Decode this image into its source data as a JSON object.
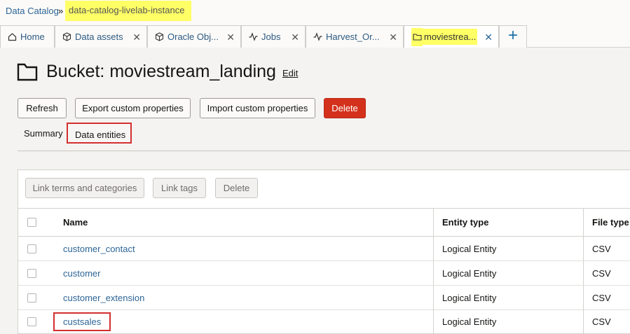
{
  "breadcrumb": {
    "root": "Data Catalog",
    "sep": "»",
    "current": "data-catalog-livelab-instance"
  },
  "tabs": [
    {
      "label": "Home",
      "icon": "home-icon"
    },
    {
      "label": "Data assets",
      "icon": "cube-icon"
    },
    {
      "label": "Oracle Obj...",
      "icon": "cube-icon"
    },
    {
      "label": "Jobs",
      "icon": "activity-icon"
    },
    {
      "label": "Harvest_Or...",
      "icon": "activity-icon"
    },
    {
      "label": "moviestrea...",
      "icon": "folder-icon"
    }
  ],
  "close_symbol": "✕",
  "add_symbol": "+",
  "title": {
    "text": "Bucket: moviestream_landing",
    "edit": "Edit"
  },
  "actions": {
    "refresh": "Refresh",
    "export": "Export custom properties",
    "import": "Import custom properties",
    "delete": "Delete"
  },
  "subtabs": {
    "summary": "Summary",
    "entities": "Data entities"
  },
  "toolbar": {
    "link_terms": "Link terms and categories",
    "link_tags": "Link tags",
    "delete": "Delete"
  },
  "table": {
    "headers": {
      "name": "Name",
      "entity_type": "Entity type",
      "file_type": "File type"
    },
    "rows": [
      {
        "name": "customer_contact",
        "entity_type": "Logical Entity",
        "file_type": "CSV"
      },
      {
        "name": "customer",
        "entity_type": "Logical Entity",
        "file_type": "CSV"
      },
      {
        "name": "customer_extension",
        "entity_type": "Logical Entity",
        "file_type": "CSV"
      },
      {
        "name": "custsales",
        "entity_type": "Logical Entity",
        "file_type": "CSV"
      }
    ]
  },
  "colors": {
    "link": "#2d6597",
    "highlight": "#ffff66",
    "danger": "#d4311c",
    "annotation": "#d32f2f"
  }
}
